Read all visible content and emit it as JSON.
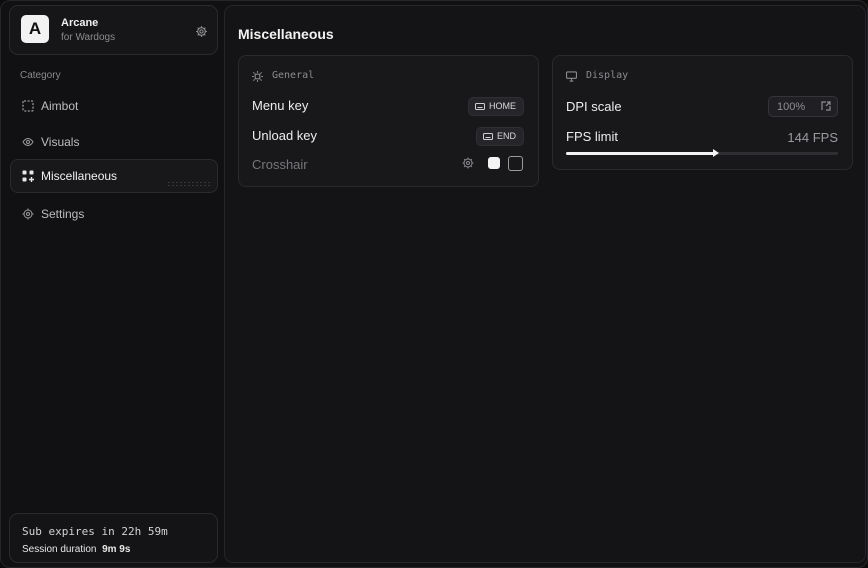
{
  "brand": {
    "logo_letter": "A",
    "title": "Arcane",
    "subtitle": "for Wardogs",
    "settings_icon": "gear-icon"
  },
  "sidebar": {
    "category_label": "Category",
    "items": [
      {
        "label": "Aimbot",
        "icon": "crosshair-dashed-icon",
        "active": false
      },
      {
        "label": "Visuals",
        "icon": "eye-icon",
        "active": false
      },
      {
        "label": "Miscellaneous",
        "icon": "grid-hash-icon",
        "active": true
      },
      {
        "label": "Settings",
        "icon": "gear-icon",
        "active": false
      }
    ]
  },
  "session": {
    "sub_expires": "Sub expires in 22h 59m",
    "duration_label": "Session duration",
    "duration_value": "9m 9s"
  },
  "main": {
    "title": "Miscellaneous",
    "general": {
      "header": "General",
      "menu_key_label": "Menu key",
      "menu_key_value": "HOME",
      "unload_key_label": "Unload key",
      "unload_key_value": "END",
      "crosshair_label": "Crosshair",
      "crosshair_color": "#f4f4f4",
      "crosshair_enabled": false
    },
    "display": {
      "header": "Display",
      "dpi_label": "DPI scale",
      "dpi_value": "100%",
      "fps_label": "FPS limit",
      "fps_value": "144 FPS",
      "fps_slider_fraction": 0.55
    }
  },
  "colors": {
    "background": "#111113",
    "panel": "#18181b",
    "accent": "#f2f2f2",
    "muted": "#8c8c90"
  }
}
